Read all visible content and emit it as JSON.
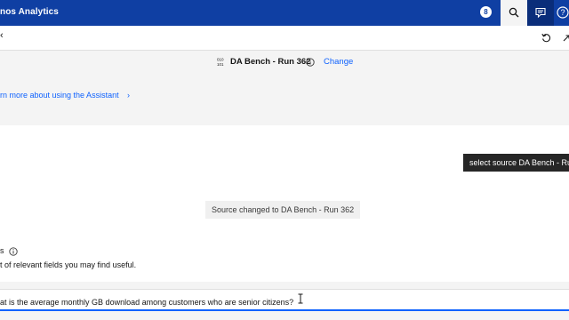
{
  "header": {
    "app_title": "nos Analytics",
    "notification_count": "8",
    "search_icon": "search-icon",
    "chat_icon": "chat-icon",
    "help_icon": "help-icon",
    "brand_color": "#0f3fa3"
  },
  "toolbar": {
    "back_glyph": "‹",
    "reset_icon": "reset-icon",
    "expand_icon": "expand-icon"
  },
  "source": {
    "name": "DA Bench - Run 362",
    "change_label": "Change"
  },
  "learn": {
    "link_text": "rn more about using the Assistant",
    "chevron": "›"
  },
  "chat": {
    "user_message": "select source DA Bench - Ru",
    "status_message": "Source changed to DA Bench - Run 362",
    "fields_title": "s",
    "fields_desc": "t of relevant fields you may find useful."
  },
  "input": {
    "value": "at is the average monthly GB download among customers who are senior citizens?"
  }
}
